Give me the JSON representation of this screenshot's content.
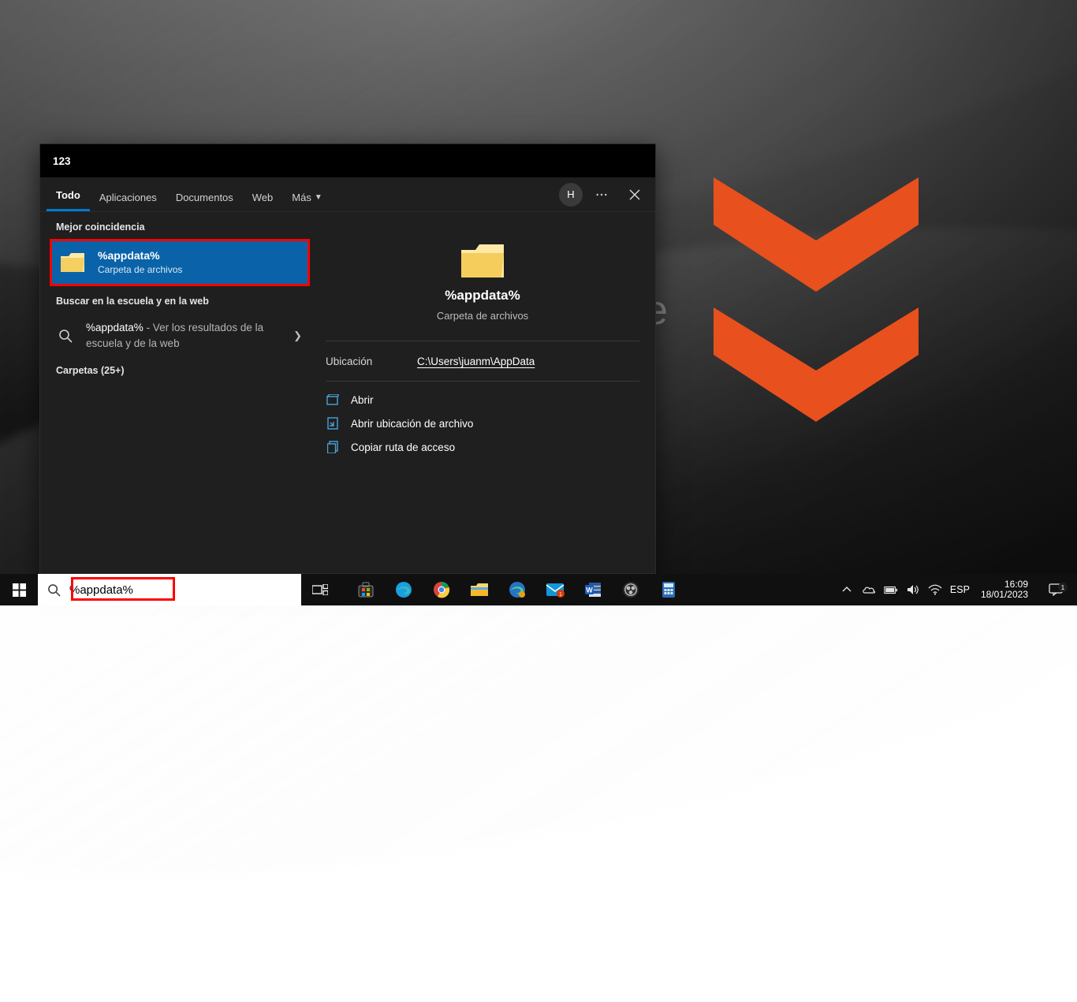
{
  "search": {
    "header": "123",
    "tabs": [
      "Todo",
      "Aplicaciones",
      "Documentos",
      "Web",
      "Más"
    ],
    "active_tab": 0,
    "account_initial": "H",
    "best_label": "Mejor coincidencia",
    "best_title": "%appdata%",
    "best_sub": "Carpeta de archivos",
    "web_label": "Buscar en la escuela y en la web",
    "web_term": "%appdata%",
    "web_suffix": " - Ver los resultados de la escuela y de la web",
    "folders_label": "Carpetas (25+)",
    "detail": {
      "title": "%appdata%",
      "sub": "Carpeta de archivos",
      "loc_key": "Ubicación",
      "loc_val": "C:\\Users\\juanm\\AppData",
      "actions": [
        "Abrir",
        "Abrir ubicación de archivo",
        "Copiar ruta de acceso"
      ]
    }
  },
  "taskbar": {
    "search_value": "%appdata%",
    "lang": "ESP",
    "time": "16:09",
    "date": "18/01/2023",
    "notif_count": "1"
  }
}
